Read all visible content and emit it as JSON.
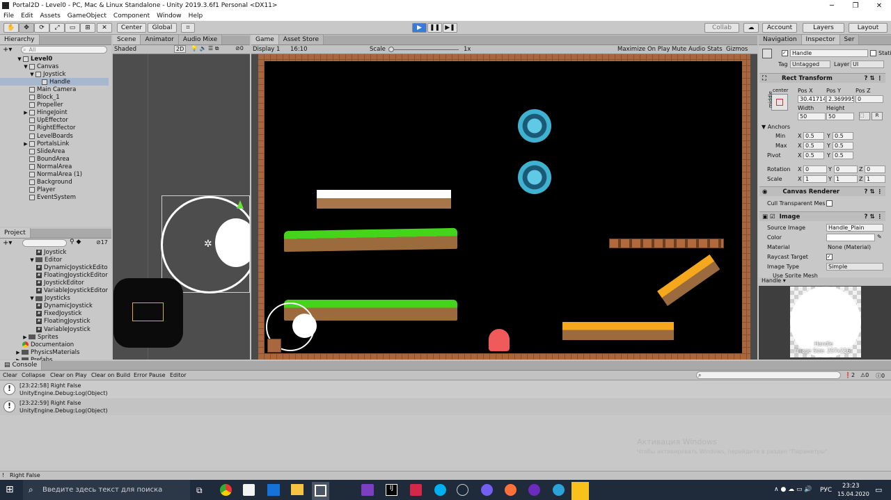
{
  "title": "Portal2D - Level0 - PC, Mac & Linux Standalone - Unity 2019.3.6f1 Personal <DX11>",
  "menu": [
    "File",
    "Edit",
    "Assets",
    "GameObject",
    "Component",
    "Window",
    "Help"
  ],
  "toolbar": {
    "center": "Center",
    "global": "Global",
    "collab": "Collab",
    "account": "Account",
    "layers": "Layers",
    "layout": "Layout"
  },
  "hierarchy": {
    "tab": "Hierarchy",
    "search": "All",
    "items": [
      {
        "name": "Level0",
        "depth": 0,
        "fold": "▼",
        "type": "scene"
      },
      {
        "name": "Canvas",
        "depth": 1,
        "fold": "▼",
        "type": "go"
      },
      {
        "name": "Joystick",
        "depth": 2,
        "fold": "▼",
        "type": "go"
      },
      {
        "name": "Handle",
        "depth": 3,
        "fold": "",
        "type": "go",
        "selected": true
      },
      {
        "name": "Main Camera",
        "depth": 1,
        "fold": "",
        "type": "go"
      },
      {
        "name": "Block_1",
        "depth": 1,
        "fold": "",
        "type": "go"
      },
      {
        "name": "Propeller",
        "depth": 1,
        "fold": "",
        "type": "go"
      },
      {
        "name": "HingeJoint",
        "depth": 1,
        "fold": "▶",
        "type": "go"
      },
      {
        "name": "UpEffector",
        "depth": 1,
        "fold": "",
        "type": "go"
      },
      {
        "name": "RightEffector",
        "depth": 1,
        "fold": "",
        "type": "go"
      },
      {
        "name": "LevelBoards",
        "depth": 1,
        "fold": "",
        "type": "go"
      },
      {
        "name": "PortalsLink",
        "depth": 1,
        "fold": "▶",
        "type": "go"
      },
      {
        "name": "SlideArea",
        "depth": 1,
        "fold": "",
        "type": "go"
      },
      {
        "name": "BoundArea",
        "depth": 1,
        "fold": "",
        "type": "go"
      },
      {
        "name": "NormalArea",
        "depth": 1,
        "fold": "",
        "type": "go"
      },
      {
        "name": "NormalArea (1)",
        "depth": 1,
        "fold": "",
        "type": "go"
      },
      {
        "name": "Background",
        "depth": 1,
        "fold": "",
        "type": "go"
      },
      {
        "name": "Player",
        "depth": 1,
        "fold": "",
        "type": "go"
      },
      {
        "name": "EventSystem",
        "depth": 1,
        "fold": "",
        "type": "go"
      }
    ]
  },
  "project": {
    "tab": "Project",
    "count": "17",
    "items": [
      {
        "name": "Joystick",
        "depth": 3,
        "type": "script"
      },
      {
        "name": "Editor",
        "depth": 2,
        "type": "folder",
        "fold": "▼"
      },
      {
        "name": "DynamicJoystickEdito",
        "depth": 3,
        "type": "script"
      },
      {
        "name": "FloatingJoystickEditor",
        "depth": 3,
        "type": "script"
      },
      {
        "name": "JoystickEditor",
        "depth": 3,
        "type": "script"
      },
      {
        "name": "VariableJoystickEditor",
        "depth": 3,
        "type": "script"
      },
      {
        "name": "Joysticks",
        "depth": 2,
        "type": "folder",
        "fold": "▼"
      },
      {
        "name": "DynamicJoystick",
        "depth": 3,
        "type": "script"
      },
      {
        "name": "FixedJoystick",
        "depth": 3,
        "type": "script"
      },
      {
        "name": "FloatingJoystick",
        "depth": 3,
        "type": "script"
      },
      {
        "name": "VariableJoystick",
        "depth": 3,
        "type": "script"
      },
      {
        "name": "Sprites",
        "depth": 1,
        "type": "folder",
        "fold": "▶"
      },
      {
        "name": "Documentaion",
        "depth": 1,
        "type": "chrome"
      },
      {
        "name": "PhysicsMaterials",
        "depth": 0,
        "type": "folder",
        "fold": "▶"
      },
      {
        "name": "Prefabs",
        "depth": 0,
        "type": "folder",
        "fold": "▶"
      }
    ]
  },
  "scene": {
    "tabs": [
      "Scene",
      "Animator",
      "Audio Mixe"
    ],
    "shaded": "Shaded",
    "twod": "2D",
    "gizmo_count": "0"
  },
  "game": {
    "tabs": [
      "Game",
      "Asset Store"
    ],
    "display": "Display 1",
    "aspect": "16:10",
    "scale_label": "Scale",
    "scale_value": "1x",
    "buttons": [
      "Maximize On Play",
      "Mute Audio",
      "Stats",
      "Gizmos"
    ]
  },
  "inspector": {
    "tabs": [
      "Navigation",
      "Inspector",
      "Ser"
    ],
    "name": "Handle",
    "static": "Static",
    "tag_label": "Tag",
    "tag": "Untagged",
    "layer_label": "Layer",
    "layer": "UI",
    "rect": {
      "title": "Rect Transform",
      "anchor_top": "center",
      "anchor_side": "middle",
      "posx_l": "Pos X",
      "posy_l": "Pos Y",
      "posz_l": "Pos Z",
      "posx": "30.41714",
      "posy": "2.369995",
      "posz": "0",
      "width_l": "Width",
      "height_l": "Height",
      "width": "50",
      "height": "50",
      "anchors": "Anchors",
      "min": "Min",
      "max": "Max",
      "pivot": "Pivot",
      "min_x": "0.5",
      "min_y": "0.5",
      "max_x": "0.5",
      "max_y": "0.5",
      "pivot_x": "0.5",
      "pivot_y": "0.5",
      "rotation": "Rotation",
      "rot_x": "0",
      "rot_y": "0",
      "rot_z": "0",
      "scale": "Scale",
      "sc_x": "1",
      "sc_y": "1",
      "sc_z": "1"
    },
    "canvas_renderer": {
      "title": "Canvas Renderer",
      "cull": "Cull Transparent Mes"
    },
    "image": {
      "title": "Image",
      "source_l": "Source Image",
      "source": "Handle_Plain",
      "color_l": "Color",
      "material_l": "Material",
      "material": "None (Material)",
      "raycast_l": "Raycast Target",
      "type_l": "Image Type",
      "type": "Simple",
      "use_sprite": "Use Sprite Mesh"
    },
    "preview": {
      "label": "Handle",
      "name": "Handle",
      "size": "Image Size: 257x256"
    }
  },
  "console": {
    "tab": "Console",
    "buttons": [
      "Clear",
      "Collapse",
      "Clear on Play",
      "Clear on Build",
      "Error Pause",
      "Editor"
    ],
    "counts": [
      "2",
      "0",
      "0"
    ],
    "logs": [
      {
        "line1": "[23:22:58] Right False",
        "line2": "UnityEngine.Debug:Log(Object)"
      },
      {
        "line1": "[23:22:59] Right False",
        "line2": "UnityEngine.Debug:Log(Object)"
      }
    ],
    "status": "Right False",
    "watermark1": "Активация Windows",
    "watermark2": "Чтобы активировать Windows, перейдите в раздел \"Параметры\"."
  },
  "taskbar": {
    "search": "Введите здесь текст для поиска",
    "lang": "РУС",
    "time": "23:23",
    "date": "15.04.2020"
  },
  "colors": {
    "accent": "#2a6bd3",
    "grass": "#44d41b",
    "dirt": "#9b6a3d",
    "brick": "#b06a3e",
    "orange": "#f5a81c"
  }
}
